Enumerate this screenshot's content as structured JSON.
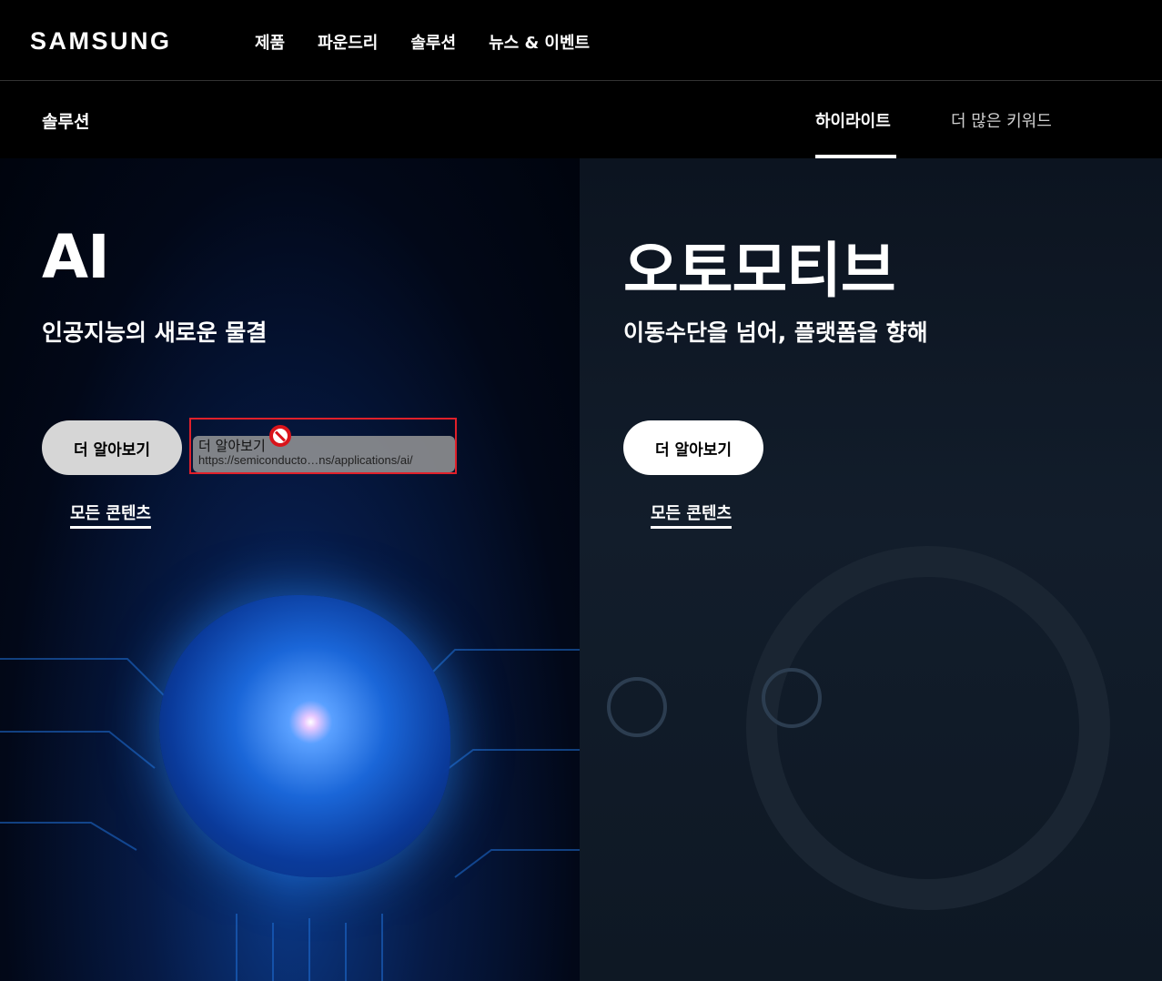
{
  "header": {
    "logo": "SAMSUNG",
    "menu": [
      "제품",
      "파운드리",
      "솔루션",
      "뉴스 & 이벤트"
    ]
  },
  "subnav": {
    "title": "솔루션",
    "tabs": [
      {
        "label": "하이라이트",
        "active": true
      },
      {
        "label": "더 많은 키워드",
        "active": false
      }
    ]
  },
  "panels": [
    {
      "title": "AI",
      "subtitle": "인공지능의 새로운 물결",
      "button": "더 알아보기",
      "link": "모든 콘텐츠"
    },
    {
      "title": "오토모티브",
      "subtitle": "이동수단을 넘어, 플랫폼을 향해",
      "button": "더 알아보기",
      "link": "모든 콘텐츠"
    }
  ],
  "drag_ghost": {
    "label": "더 알아보기",
    "url": "https://semiconducto…ns/applications/ai/"
  },
  "colors": {
    "background": "#000000",
    "drag_outline": "#e0202a",
    "nodrop_icon": "#d9141b"
  }
}
